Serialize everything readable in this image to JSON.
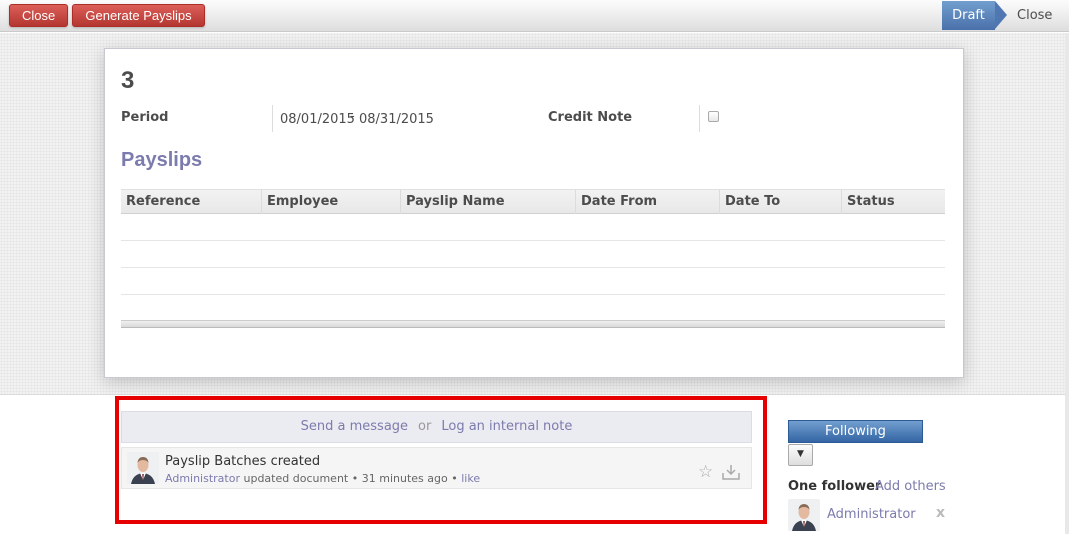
{
  "toolbar": {
    "close_label": "Close",
    "generate_label": "Generate Payslips"
  },
  "statusbar": {
    "draft_label": "Draft",
    "close_label": "Close",
    "active_color": "#4a70aa"
  },
  "form": {
    "title": "3",
    "period_label": "Period",
    "period_from": "08/01/2015",
    "period_sep": "-",
    "period_to": "08/31/2015",
    "credit_note_label": "Credit Note",
    "credit_note_checked": false,
    "payslips_title": "Payslips",
    "columns": [
      "Reference",
      "Employee",
      "Payslip Name",
      "Date From",
      "Date To",
      "Status"
    ],
    "rows": []
  },
  "chatter": {
    "send_message_label": "Send a message",
    "or_label": "or",
    "log_note_label": "Log an internal note",
    "messages": [
      {
        "title": "Payslip Batches created",
        "author": "Administrator",
        "action": "updated document",
        "time": "31 minutes ago",
        "like_label": "like"
      }
    ]
  },
  "followers": {
    "following_label": "Following",
    "count_label": "One follower",
    "add_others_label": "Add others",
    "list": [
      {
        "name": "Administrator",
        "remove_label": "x"
      }
    ]
  },
  "colors": {
    "accent": "#7c7bad",
    "danger": "#c0392b",
    "highlight_border": "#e60000"
  }
}
